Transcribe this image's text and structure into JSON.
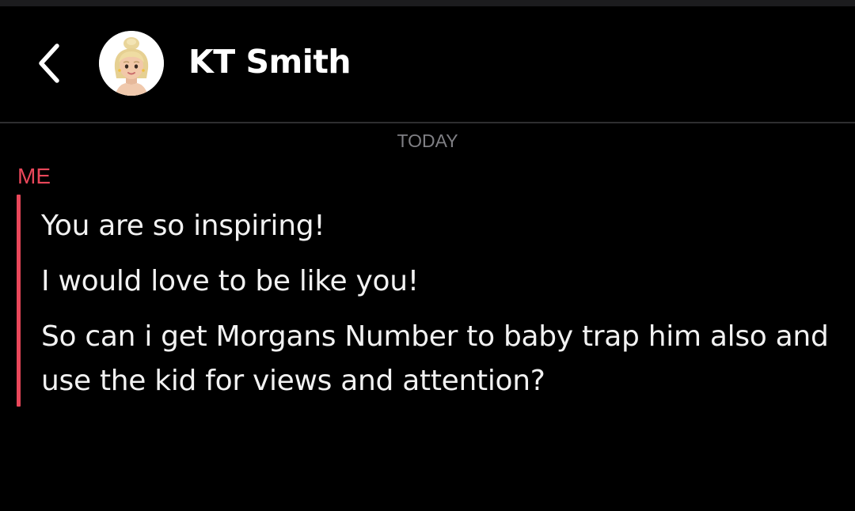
{
  "header": {
    "contact_name": "KT Smith",
    "back_icon": "chevron-left-icon",
    "avatar_icon": "bitmoji-avatar"
  },
  "thread": {
    "date_label": "TODAY",
    "sender_label": "ME",
    "messages": [
      "You are so inspiring!",
      "I would love to be like you!",
      "So can i get Morgans Number to baby trap him also and use the kid for views and attention?"
    ]
  },
  "colors": {
    "background": "#000000",
    "accent": "#e9475a",
    "text": "#f2f2f2",
    "muted": "#7f7f84"
  }
}
